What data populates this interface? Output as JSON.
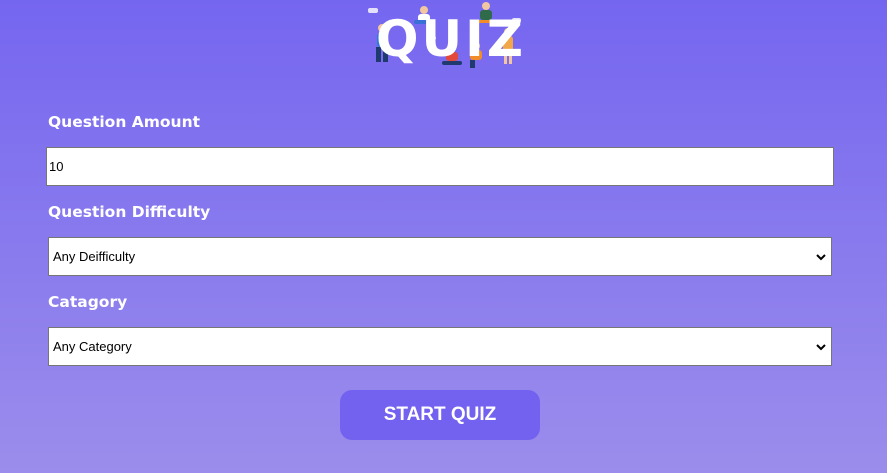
{
  "logo": {
    "text": "QUIZ"
  },
  "form": {
    "amount": {
      "label": "Question Amount",
      "value": "10"
    },
    "difficulty": {
      "label": "Question Difficulty",
      "selected": "Any Deifficulty"
    },
    "category": {
      "label": "Catagory",
      "selected": "Any Category"
    }
  },
  "start_button": {
    "label": "START QUIZ"
  },
  "colors": {
    "background_top": "#7566f0",
    "background_bottom": "#9b8deb",
    "button": "#7362f0"
  }
}
